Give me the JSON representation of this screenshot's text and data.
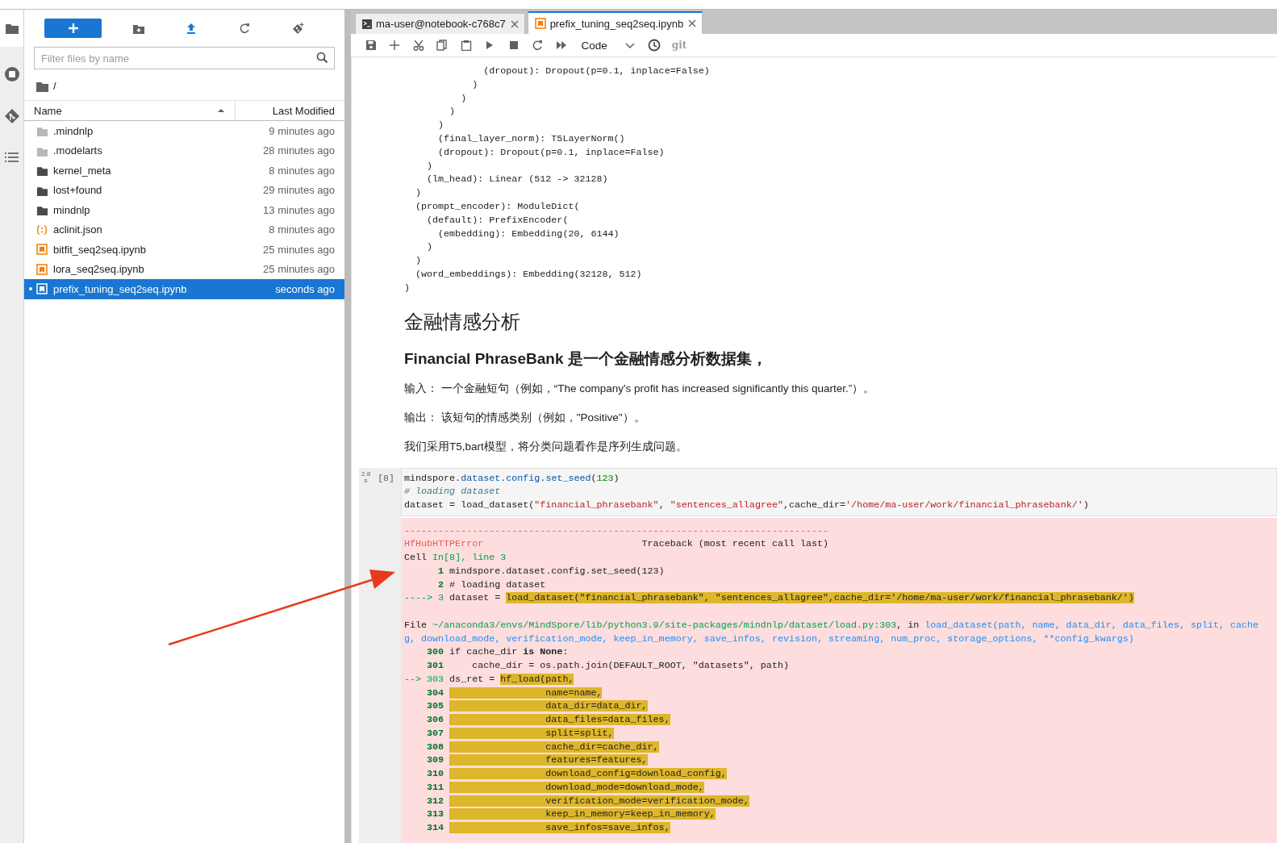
{
  "filter": {
    "placeholder": "Filter files by name"
  },
  "path": "/",
  "columns": [
    {
      "label": "Name",
      "sorted": true
    },
    {
      "label": "Last Modified",
      "sorted": false
    }
  ],
  "files": [
    {
      "name": ".mindnlp",
      "kind": "folder",
      "modified": "9 minutes ago",
      "hidden": true,
      "running": false,
      "selected": false
    },
    {
      "name": ".modelarts",
      "kind": "folder",
      "modified": "28 minutes ago",
      "hidden": true,
      "running": false,
      "selected": false
    },
    {
      "name": "kernel_meta",
      "kind": "folder",
      "modified": "8 minutes ago",
      "hidden": false,
      "running": false,
      "selected": false
    },
    {
      "name": "lost+found",
      "kind": "folder",
      "modified": "29 minutes ago",
      "hidden": false,
      "running": false,
      "selected": false
    },
    {
      "name": "mindnlp",
      "kind": "folder",
      "modified": "13 minutes ago",
      "hidden": false,
      "running": false,
      "selected": false
    },
    {
      "name": "aclinit.json",
      "kind": "json",
      "modified": "8 minutes ago",
      "running": false,
      "selected": false
    },
    {
      "name": "bitfit_seq2seq.ipynb",
      "kind": "notebook",
      "modified": "25 minutes ago",
      "running": false,
      "selected": false
    },
    {
      "name": "lora_seq2seq.ipynb",
      "kind": "notebook",
      "modified": "25 minutes ago",
      "running": false,
      "selected": false
    },
    {
      "name": "prefix_tuning_seq2seq.ipynb",
      "kind": "notebook",
      "modified": "seconds ago",
      "running": true,
      "selected": true
    }
  ],
  "tabs": [
    {
      "label": "ma-user@notebook-c768c7",
      "kind": "terminal",
      "selected": false
    },
    {
      "label": "prefix_tuning_seq2seq.ipynb",
      "kind": "notebook",
      "selected": true
    }
  ],
  "toolbar": {
    "cell_type": "Code",
    "git": "git"
  },
  "output_lines": [
    "              (dropout): Dropout(p=0.1, inplace=False)",
    "            )",
    "          )",
    "        )",
    "      )",
    "      (final_layer_norm): T5LayerNorm()",
    "      (dropout): Dropout(p=0.1, inplace=False)",
    "    )",
    "    (lm_head): Linear (512 -> 32128)",
    "  )",
    "  (prompt_encoder): ModuleDict(",
    "    (default): PrefixEncoder(",
    "      (embedding): Embedding(20, 6144)",
    "    )",
    "  )",
    "  (word_embeddings): Embedding(32128, 512)",
    ")"
  ],
  "markdown": {
    "h1": "金融情感分析",
    "h2": "Financial PhraseBank 是一个金融情感分析数据集，",
    "paragraphs": [
      "输入： 一个金融短句（例如，“The company's profit has increased significantly this quarter.”）。",
      "输出： 该短句的情感类别（例如，\"Positive\"）。",
      "我们采用T5,bart模型，将分类问题看作是序列生成问题。"
    ]
  },
  "cell": {
    "timing_value": "2.8",
    "timing_unit": "s",
    "prompt": "[8]",
    "lines": [
      [
        {
          "kind": "plain",
          "text": "mindspore."
        },
        {
          "kind": "attribute",
          "text": "dataset"
        },
        {
          "kind": "plain",
          "text": "."
        },
        {
          "kind": "attribute",
          "text": "config"
        },
        {
          "kind": "plain",
          "text": "."
        },
        {
          "kind": "attribute",
          "text": "set_seed"
        },
        {
          "kind": "plain",
          "text": "("
        },
        {
          "kind": "number",
          "text": "123"
        },
        {
          "kind": "plain",
          "text": ")"
        }
      ],
      [
        {
          "kind": "comment",
          "text": "# loading dataset"
        }
      ],
      [
        {
          "kind": "plain",
          "text": "dataset = load_dataset("
        },
        {
          "kind": "string",
          "text": "\"financial_phrasebank\""
        },
        {
          "kind": "plain",
          "text": ", "
        },
        {
          "kind": "string",
          "text": "\"sentences_allagree\""
        },
        {
          "kind": "plain",
          "text": ",cache_dir="
        },
        {
          "kind": "string",
          "text": "'/home/ma-user/work/financial_phrasebank/'"
        },
        {
          "kind": "plain",
          "text": ")"
        }
      ]
    ]
  },
  "error_lines": [
    {
      "kind": "trace",
      "segments": [
        {
          "kind": "error_name",
          "text": "---------------------------------------------------------------------------"
        }
      ]
    },
    {
      "kind": "trace",
      "segments": [
        {
          "kind": "error_name",
          "text": "HfHubHTTPError"
        },
        {
          "kind": "plain",
          "text": "                            Traceback (most recent call last)"
        }
      ]
    },
    {
      "kind": "trace",
      "segments": [
        {
          "kind": "plain",
          "text": "Cell "
        },
        {
          "kind": "location",
          "text": "In[8], line 3"
        }
      ]
    },
    {
      "kind": "trace",
      "segments": [
        {
          "kind": "line_number",
          "text": "      1 "
        },
        {
          "kind": "plain",
          "text": "mindspore.dataset.config.set_seed(123)"
        }
      ]
    },
    {
      "kind": "trace",
      "segments": [
        {
          "kind": "line_number",
          "text": "      2 "
        },
        {
          "kind": "plain",
          "text": "# loading dataset"
        }
      ]
    },
    {
      "kind": "trace",
      "segments": [
        {
          "kind": "location",
          "text": "----> 3 "
        },
        {
          "kind": "plain",
          "text": "dataset = "
        },
        {
          "kind": "highlighted",
          "text": "load_dataset(\"financial_phrasebank\", \"sentences_allagree\",cache_dir='/home/ma-user/work/financial_phrasebank/')"
        }
      ]
    },
    {
      "kind": "frame_header",
      "segments": [
        {
          "kind": "plain",
          "text": "File "
        },
        {
          "kind": "location",
          "text": "~/anaconda3/envs/MindSpore/lib/python3.9/site-packages/mindnlp/dataset/load.py:303"
        },
        {
          "kind": "plain",
          "text": ", in "
        },
        {
          "kind": "function",
          "text": "load_dataset(path, name, data_dir, data_files, split, cache"
        }
      ]
    },
    {
      "kind": "trace",
      "segments": [
        {
          "kind": "function",
          "text": "g, download_mode, verification_mode, keep_in_memory, save_infos, revision, streaming, num_proc, storage_options, **config_kwargs)"
        }
      ]
    },
    {
      "kind": "trace",
      "segments": [
        {
          "kind": "line_number",
          "text": "    300 "
        },
        {
          "kind": "plain",
          "text": "if cache_dir "
        },
        {
          "kind": "keyword",
          "text": "is None"
        },
        {
          "kind": "plain",
          "text": ":"
        }
      ]
    },
    {
      "kind": "trace",
      "segments": [
        {
          "kind": "line_number",
          "text": "    301 "
        },
        {
          "kind": "plain",
          "text": "    cache_dir = os.path.join(DEFAULT_ROOT, \"datasets\", path)"
        }
      ]
    },
    {
      "kind": "trace",
      "segments": [
        {
          "kind": "location",
          "text": "--> 303 "
        },
        {
          "kind": "plain",
          "text": "ds_ret = "
        },
        {
          "kind": "highlighted",
          "text": "hf_load(path,"
        }
      ]
    },
    {
      "kind": "trace",
      "segments": [
        {
          "kind": "line_number",
          "text": "    304 "
        },
        {
          "kind": "highlighted",
          "text": "                 name=name,"
        }
      ]
    },
    {
      "kind": "trace",
      "segments": [
        {
          "kind": "line_number",
          "text": "    305 "
        },
        {
          "kind": "highlighted",
          "text": "                 data_dir=data_dir,"
        }
      ]
    },
    {
      "kind": "trace",
      "segments": [
        {
          "kind": "line_number",
          "text": "    306 "
        },
        {
          "kind": "highlighted",
          "text": "                 data_files=data_files,"
        }
      ]
    },
    {
      "kind": "trace",
      "segments": [
        {
          "kind": "line_number",
          "text": "    307 "
        },
        {
          "kind": "highlighted",
          "text": "                 split=split,"
        }
      ]
    },
    {
      "kind": "trace",
      "segments": [
        {
          "kind": "line_number",
          "text": "    308 "
        },
        {
          "kind": "highlighted",
          "text": "                 cache_dir=cache_dir,"
        }
      ]
    },
    {
      "kind": "trace",
      "segments": [
        {
          "kind": "line_number",
          "text": "    309 "
        },
        {
          "kind": "highlighted",
          "text": "                 features=features,"
        }
      ]
    },
    {
      "kind": "trace",
      "segments": [
        {
          "kind": "line_number",
          "text": "    310 "
        },
        {
          "kind": "highlighted",
          "text": "                 download_config=download_config,"
        }
      ]
    },
    {
      "kind": "trace",
      "segments": [
        {
          "kind": "line_number",
          "text": "    311 "
        },
        {
          "kind": "highlighted",
          "text": "                 download_mode=download_mode,"
        }
      ]
    },
    {
      "kind": "trace",
      "segments": [
        {
          "kind": "line_number",
          "text": "    312 "
        },
        {
          "kind": "highlighted",
          "text": "                 verification_mode=verification_mode,"
        }
      ]
    },
    {
      "kind": "trace",
      "segments": [
        {
          "kind": "line_number",
          "text": "    313 "
        },
        {
          "kind": "highlighted",
          "text": "                 keep_in_memory=keep_in_memory,"
        }
      ]
    },
    {
      "kind": "trace",
      "segments": [
        {
          "kind": "line_number",
          "text": "    314 "
        },
        {
          "kind": "highlighted",
          "text": "                 save_infos=save_infos,"
        }
      ]
    }
  ]
}
